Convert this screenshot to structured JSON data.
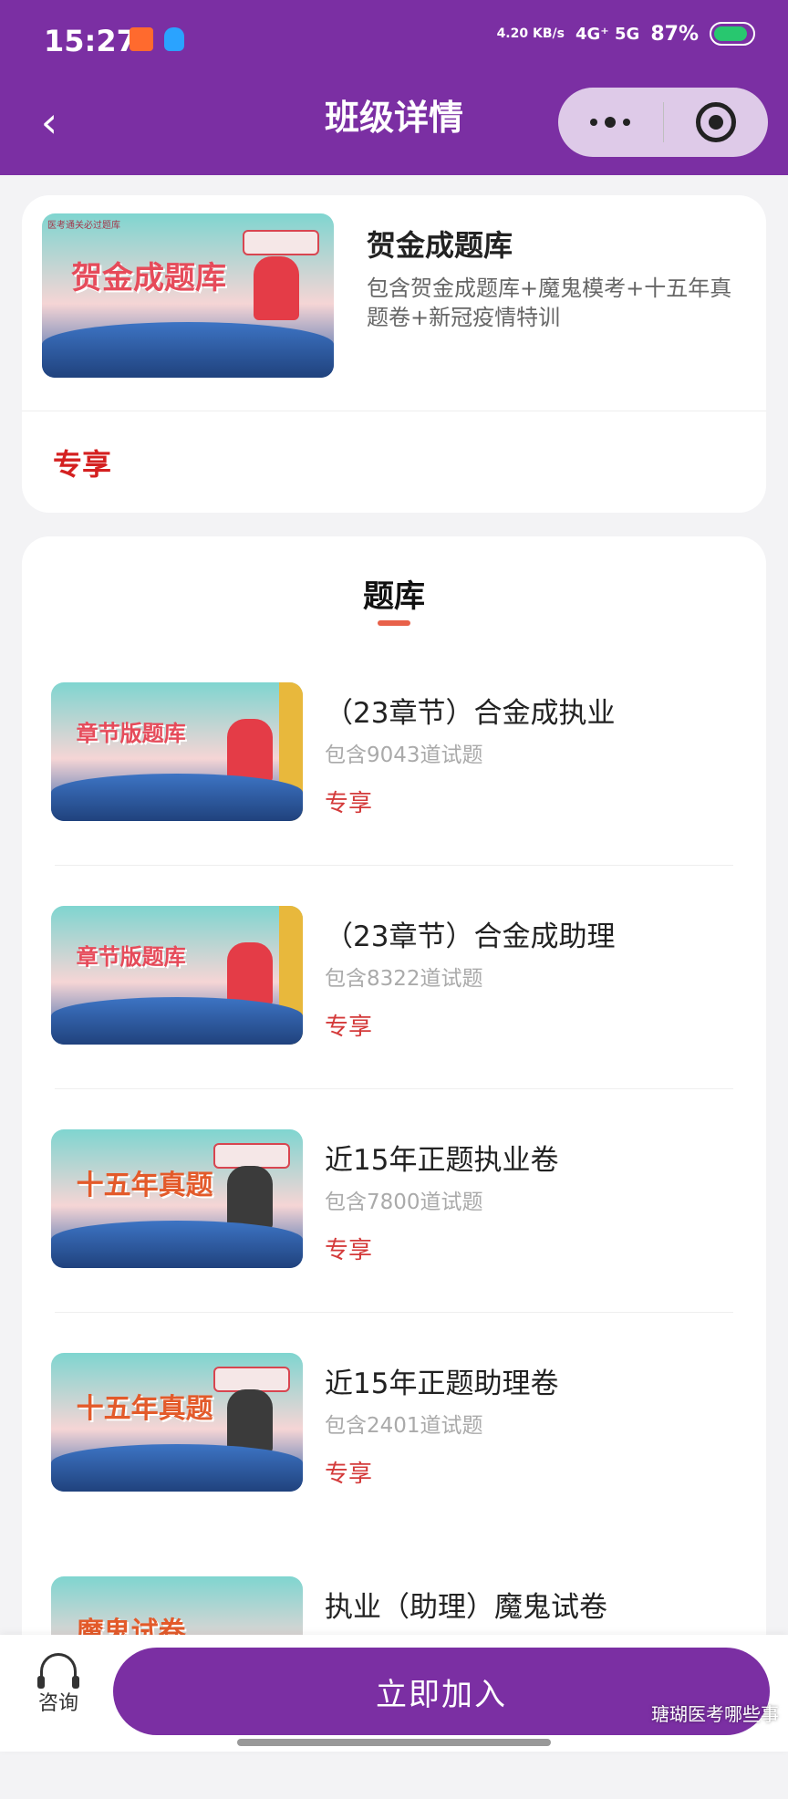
{
  "status_bar": {
    "time": "15:27",
    "speed": "4.20 KB/s",
    "network": "4G⁺ 5G",
    "battery": "87%"
  },
  "nav": {
    "title": "班级详情",
    "back_icon": "‹"
  },
  "course": {
    "title": "贺金成题库",
    "description": "包含贺金成题库+魔鬼模考+十五年真题卷+新冠疫情特训",
    "badge": "专享",
    "thumb_text": "贺金成题库",
    "thumb_tag": "医考通关必过题库"
  },
  "question_bank": {
    "section_title": "题库",
    "items": [
      {
        "title": "（23章节）合金成执业",
        "count": "包含9043道试题",
        "badge": "专享",
        "thumb_text": "章节版题库"
      },
      {
        "title": "（23章节）合金成助理",
        "count": "包含8322道试题",
        "badge": "专享",
        "thumb_text": "章节版题库"
      },
      {
        "title": "近15年正题执业卷",
        "count": "包含7800道试题",
        "badge": "专享",
        "thumb_text": "十五年真题"
      },
      {
        "title": "近15年正题助理卷",
        "count": "包含2401道试题",
        "badge": "专享",
        "thumb_text": "十五年真题"
      },
      {
        "title": "执业（助理）魔鬼试卷",
        "count": "",
        "badge": "",
        "thumb_text": "魔鬼试卷"
      }
    ]
  },
  "bottom": {
    "consult_label": "咨询",
    "join_label": "立即加入",
    "watermark": "瑭瑚医考哪些事"
  },
  "colors": {
    "brand": "#7b2fa3",
    "badge_red": "#d42020",
    "accent_line": "#e8614a"
  }
}
